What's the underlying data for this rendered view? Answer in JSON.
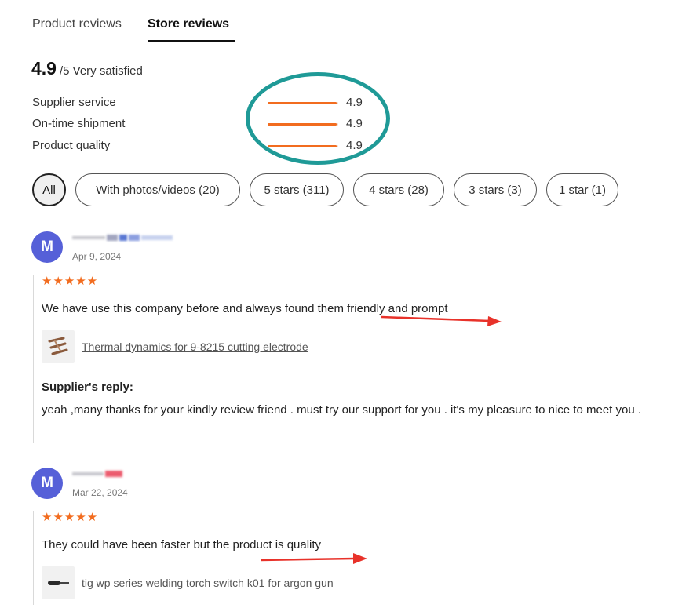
{
  "tabs": [
    {
      "label": "Product reviews",
      "active": false
    },
    {
      "label": "Store reviews",
      "active": true
    }
  ],
  "overall": {
    "score": "4.9",
    "suffix": "/5 Very satisfied"
  },
  "metrics": [
    {
      "label": "Supplier service",
      "value": "4.9",
      "fraction": 0.98
    },
    {
      "label": "On-time shipment",
      "value": "4.9",
      "fraction": 0.98
    },
    {
      "label": "Product quality",
      "value": "4.9",
      "fraction": 0.98
    }
  ],
  "filters": [
    {
      "label": "All",
      "active": true
    },
    {
      "label": "With photos/videos (20)",
      "active": false
    },
    {
      "label": "5 stars (311)",
      "active": false
    },
    {
      "label": "4 stars (28)",
      "active": false
    },
    {
      "label": "3 stars (3)",
      "active": false
    },
    {
      "label": "1 star (1)",
      "active": false
    }
  ],
  "reviews": [
    {
      "avatar_initial": "M",
      "date": "Apr 9, 2024",
      "stars": "★★★★★",
      "rating": 5,
      "text": "We have use this company before and always found them friendly and prompt",
      "product": {
        "name": "Thermal dynamics for 9-8215 cutting electrode",
        "thumb_icon": "electrode-icon"
      },
      "reply": {
        "title": "Supplier's reply:",
        "text": "yeah ,many thanks for your kindly review friend . must try our support for you . it's my pleasure to nice to meet you ."
      }
    },
    {
      "avatar_initial": "M",
      "date": "Mar 22, 2024",
      "stars": "★★★★★",
      "rating": 5,
      "text": "They could have been faster but the product is quality",
      "product": {
        "name": "tig wp series welding torch switch k01 for argon gun",
        "thumb_icon": "torch-switch-icon"
      }
    }
  ],
  "colors": {
    "accent": "#f26c1f",
    "avatar": "#5660d8",
    "annotation_circle": "#1f9a97",
    "annotation_arrow": "#e8322a"
  }
}
